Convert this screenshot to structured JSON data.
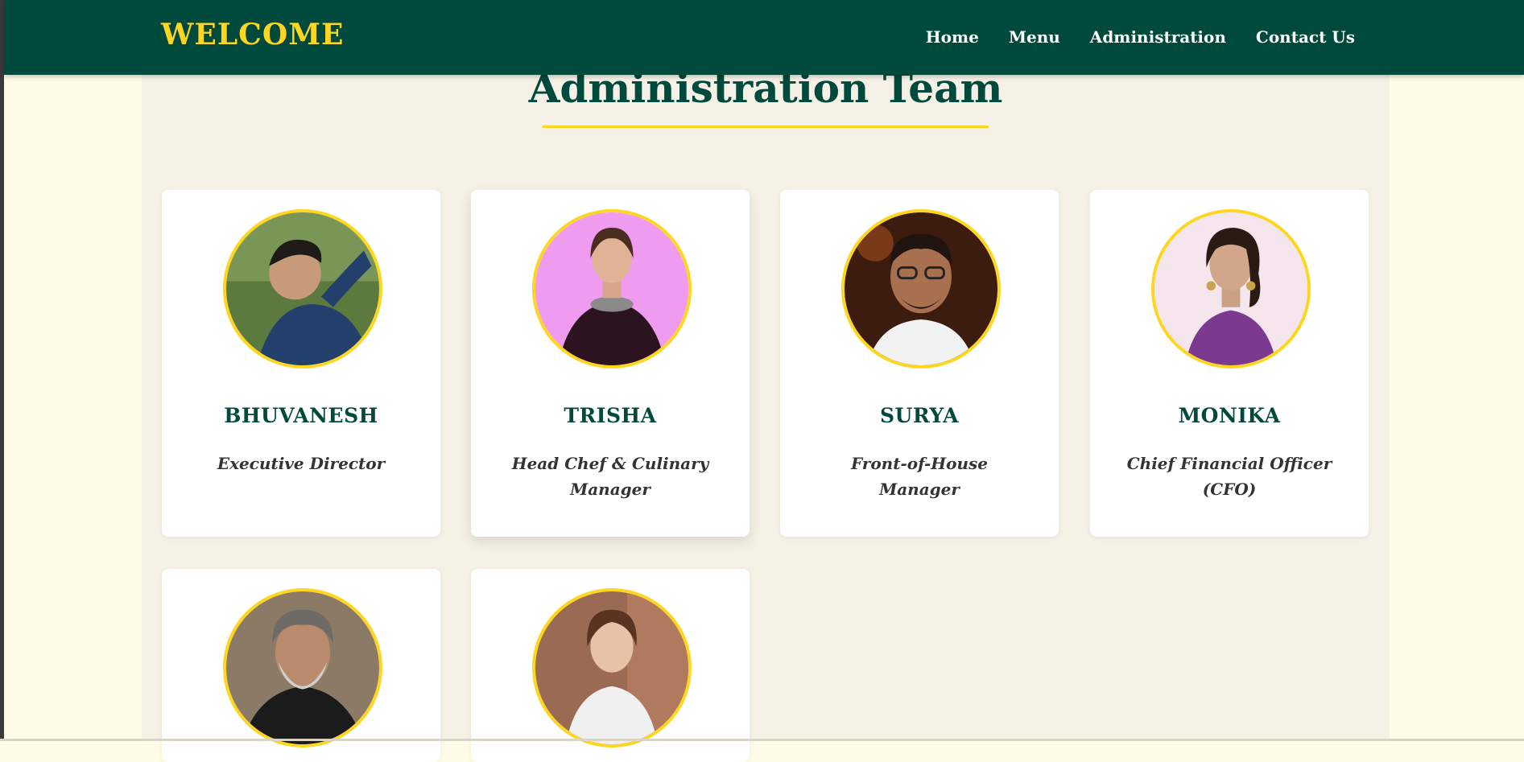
{
  "header": {
    "brand": "WELCOME",
    "nav": [
      "Home",
      "Menu",
      "Administration",
      "Contact Us"
    ]
  },
  "section": {
    "title": "Administration Team"
  },
  "team": [
    {
      "name": "BHUVANESH",
      "role": "Executive Director"
    },
    {
      "name": "TRISHA",
      "role": "Head Chef & Culinary Manager"
    },
    {
      "name": "SURYA",
      "role": "Front-of-House Manager"
    },
    {
      "name": "MONIKA",
      "role": "Chief Financial Officer (CFO)"
    },
    {
      "name": "",
      "role": ""
    },
    {
      "name": "",
      "role": ""
    }
  ],
  "colors": {
    "header_bg": "#004a3d",
    "accent": "#ffd61f",
    "page_bg": "#fffde8",
    "content_bg": "#f6f1e6"
  }
}
